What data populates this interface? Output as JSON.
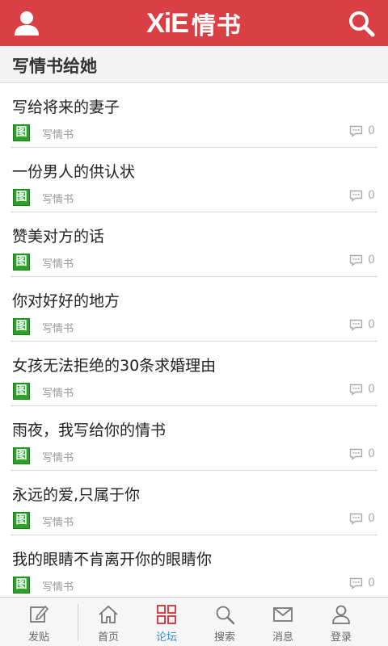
{
  "header": {
    "logo_latin": "XiE",
    "logo_cn": "情书",
    "user_icon": "user-icon",
    "search_icon": "search-icon",
    "bg_color": "#d84046"
  },
  "section": {
    "title": "写情书给她"
  },
  "posts": [
    {
      "title": "写给将来的妻子",
      "tag": "图",
      "category": "写情书",
      "comments": "0"
    },
    {
      "title": "一份男人的供认状",
      "tag": "图",
      "category": "写情书",
      "comments": "0"
    },
    {
      "title": "赞美对方的话",
      "tag": "图",
      "category": "写情书",
      "comments": "0"
    },
    {
      "title": "你对好好的地方",
      "tag": "图",
      "category": "写情书",
      "comments": "0"
    },
    {
      "title": "女孩无法拒绝的30条求婚理由",
      "tag": "图",
      "category": "写情书",
      "comments": "0"
    },
    {
      "title": "雨夜，我写给你的情书",
      "tag": "图",
      "category": "写情书",
      "comments": "0"
    },
    {
      "title": "永远的爱,只属于你",
      "tag": "图",
      "category": "写情书",
      "comments": "0"
    },
    {
      "title": "我的眼睛不肯离开你的眼睛你",
      "tag": "图",
      "category": "写情书",
      "comments": "0"
    }
  ],
  "tabbar": {
    "post": {
      "label": "发贴",
      "icon": "edit-icon"
    },
    "home": {
      "label": "首页",
      "icon": "home-icon"
    },
    "forum": {
      "label": "论坛",
      "icon": "grid-icon",
      "active": true
    },
    "search": {
      "label": "搜索",
      "icon": "search-icon"
    },
    "messages": {
      "label": "消息",
      "icon": "mail-icon"
    },
    "login": {
      "label": "登录",
      "icon": "user-icon"
    },
    "active_color": "#3a8ed8"
  }
}
